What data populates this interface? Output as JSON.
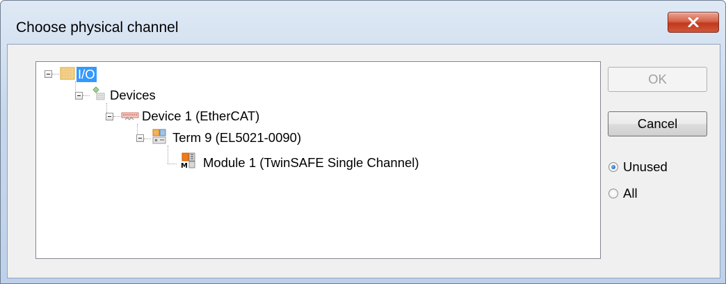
{
  "window": {
    "title": "Choose physical channel",
    "close_glyph": "x"
  },
  "tree": {
    "nodes": [
      {
        "label": "I/O",
        "icon": "io-folder-icon",
        "selected": true
      },
      {
        "label": "Devices",
        "icon": "devices-icon"
      },
      {
        "label": "Device 1 (EtherCAT)",
        "icon": "ethercat-device-icon"
      },
      {
        "label": "Term 9 (EL5021-0090)",
        "icon": "terminal-icon"
      },
      {
        "label": "Module 1 (TwinSAFE Single Channel)",
        "icon": "module-icon"
      }
    ]
  },
  "buttons": {
    "ok": "OK",
    "cancel": "Cancel"
  },
  "filter": {
    "options": [
      {
        "label": "Unused",
        "checked": true
      },
      {
        "label": "All",
        "checked": false
      }
    ]
  },
  "colors": {
    "selection": "#3399ff",
    "close_button": "#c1391c",
    "titlebar": "#c6d7ec"
  }
}
